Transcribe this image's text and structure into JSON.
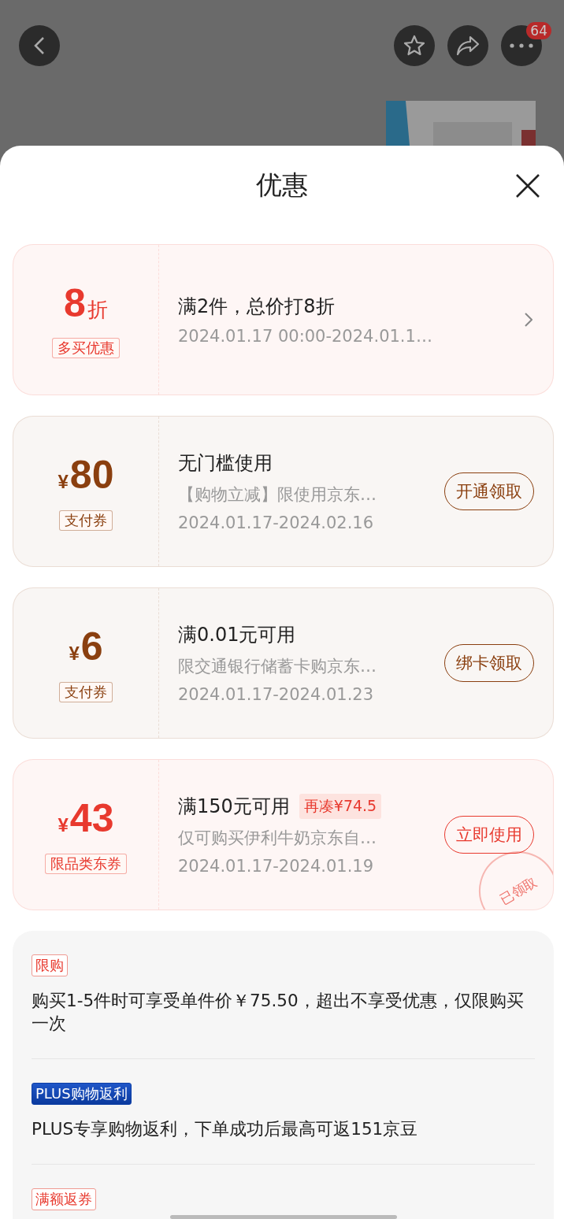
{
  "top_bar": {
    "badge": "64"
  },
  "sheet": {
    "title": "优惠"
  },
  "coupons": [
    {
      "kind": "discount",
      "color": "#e8392e",
      "amount": "8",
      "unit": "折",
      "tag": "多买优惠",
      "title": "满2件，总价打8折",
      "lines": [
        "2024.01.17 00:00-2024.01.1…"
      ]
    },
    {
      "kind": "coupon",
      "color": "#8a3f0f",
      "currency": "¥",
      "amount": "80",
      "tag": "支付券",
      "title": "无门槛使用",
      "lines": [
        "【购物立减】限使用京东…",
        "2024.01.17-2024.02.16"
      ],
      "button": "开通领取"
    },
    {
      "kind": "coupon",
      "color": "#8a3f0f",
      "currency": "¥",
      "amount": "6",
      "tag": "支付券",
      "title": "满0.01元可用",
      "lines": [
        "限交通银行储蓄卡购京东…",
        "2024.01.17-2024.01.23"
      ],
      "button": "绑卡领取"
    },
    {
      "kind": "coupon",
      "color": "#e8392e",
      "currency": "¥",
      "amount": "43",
      "tag": "限品类东券",
      "title": "满150元可用",
      "extra": "再凑¥74.5",
      "lines": [
        "仅可购买伊利牛奶京东自…",
        "2024.01.17-2024.01.19"
      ],
      "button": "立即使用",
      "stamp": "已领取"
    }
  ],
  "info": [
    {
      "kind": "outline",
      "tag": "限购",
      "text": "购买1-5件时可享受单件价￥75.50，超出不享受优惠，仅限购买一次"
    },
    {
      "kind": "filled",
      "tag": "PLUS购物返利",
      "text": "PLUS专享购物返利，下单成功后最高可返151京豆"
    },
    {
      "kind": "outline",
      "tag": "满额返券"
    }
  ]
}
